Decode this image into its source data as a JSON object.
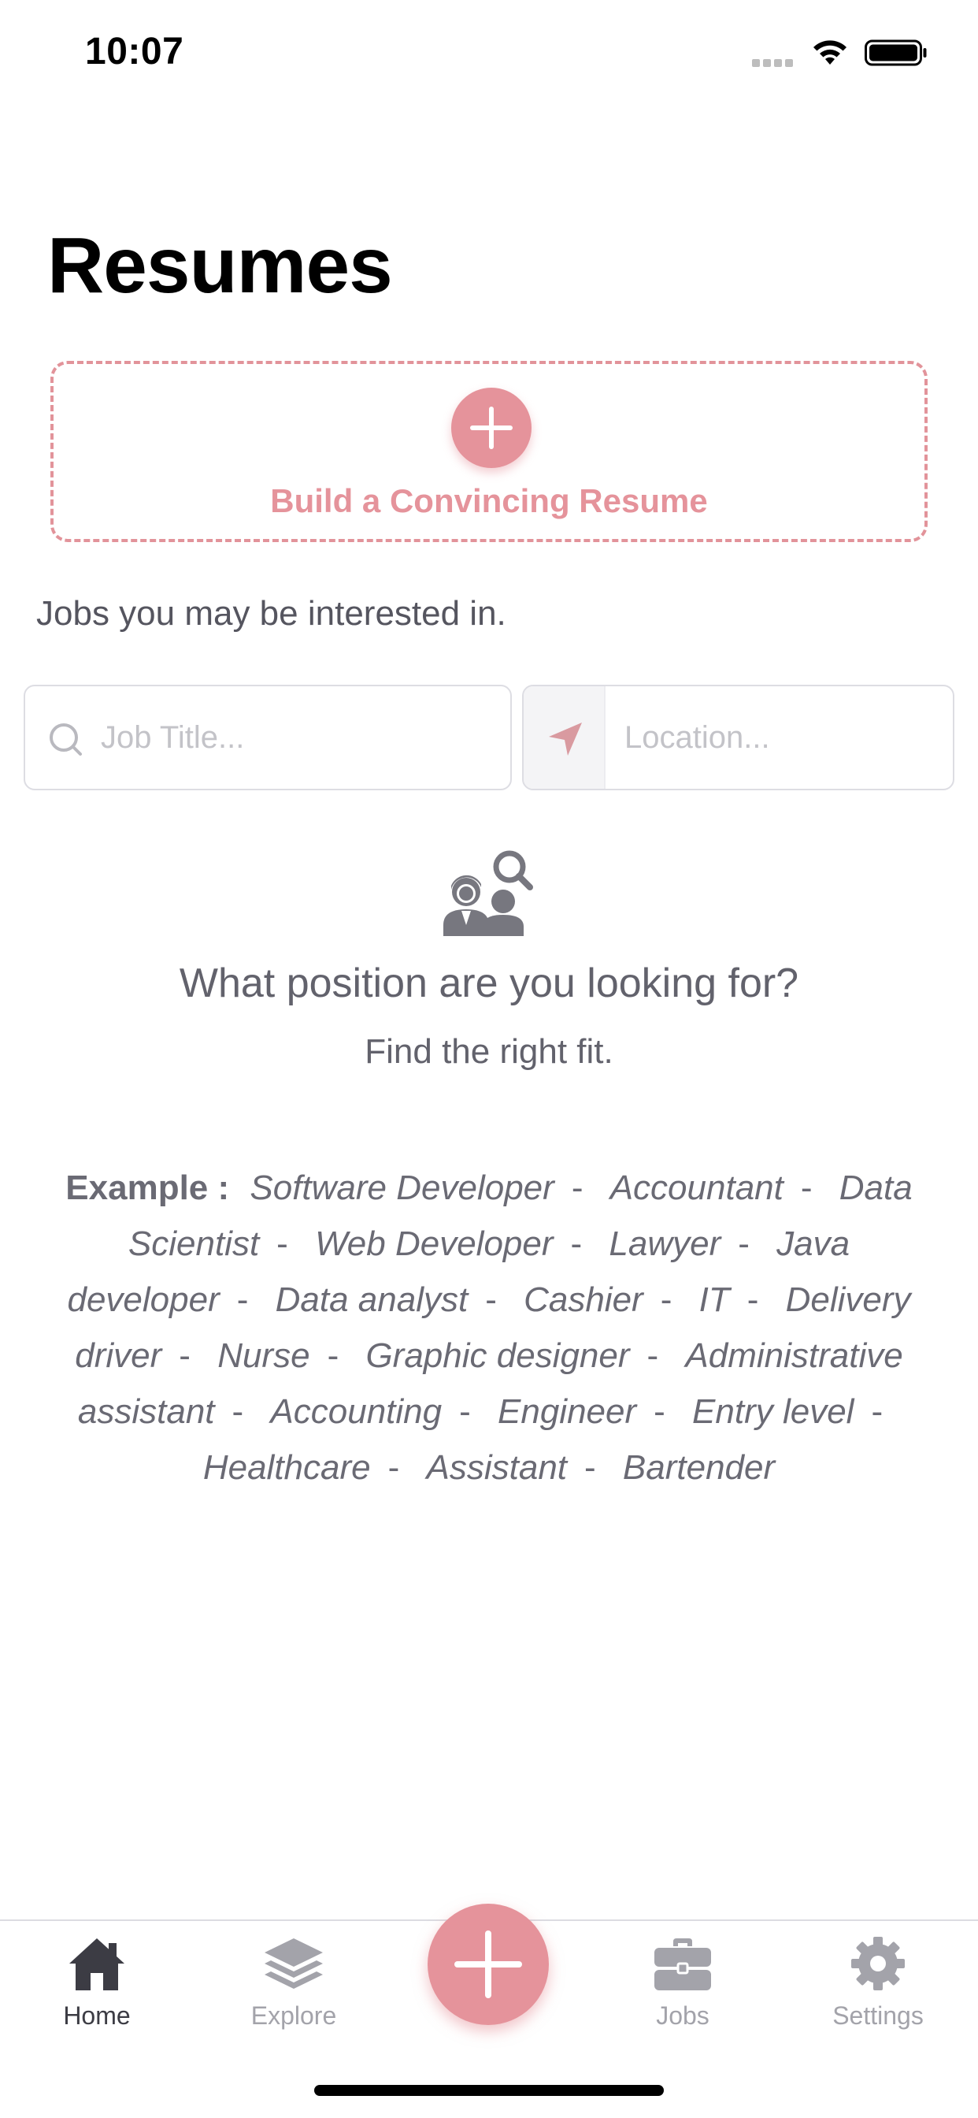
{
  "status_bar": {
    "time": "10:07"
  },
  "page": {
    "title": "Resumes"
  },
  "build_card": {
    "label": "Build a Convincing Resume"
  },
  "subheading": "Jobs you may be interested in.",
  "search": {
    "job_title_placeholder": "Job Title...",
    "location_placeholder": "Location..."
  },
  "empty_state": {
    "title": "What position are you looking for?",
    "subtitle": "Find the right fit.",
    "example_label": "Example :",
    "examples": [
      "Software Developer",
      "Accountant",
      "Data Scientist",
      "Web Developer",
      "Lawyer",
      "Java developer",
      "Data analyst",
      "Cashier",
      "IT",
      "Delivery driver",
      "Nurse",
      "Graphic designer",
      "Administrative assistant",
      "Accounting",
      "Engineer",
      "Entry level",
      "Healthcare",
      "Assistant",
      "Bartender"
    ],
    "separator": "-"
  },
  "tab_bar": {
    "home": "Home",
    "explore": "Explore",
    "jobs": "Jobs",
    "settings": "Settings",
    "active": "home"
  },
  "colors": {
    "accent": "#e5939b",
    "text_muted": "#62626c",
    "tab_inactive": "#a3a3aa",
    "tab_active": "#3c3c44"
  },
  "icons": {
    "status": [
      "signal-icon",
      "wifi-icon",
      "battery-icon"
    ],
    "search_field": "search-icon",
    "location_field": "location-arrow-icon",
    "empty_state": "people-search-icon",
    "tabs": [
      "home-icon",
      "layers-icon",
      "plus-icon",
      "briefcase-icon",
      "gear-icon"
    ]
  }
}
